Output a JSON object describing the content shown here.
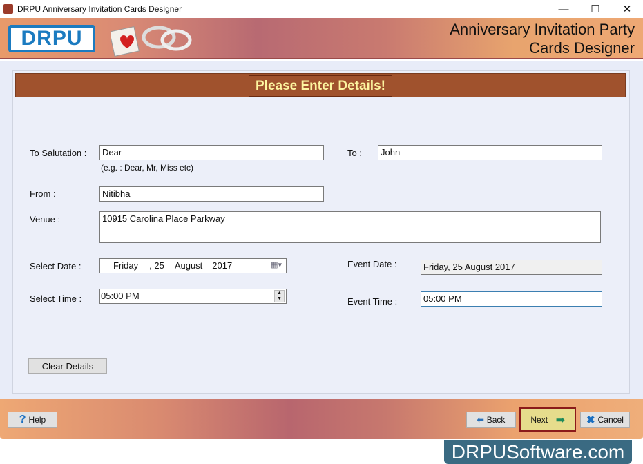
{
  "window": {
    "title": "DRPU Anniversary Invitation Cards Designer",
    "minimize": "—",
    "maximize": "☐",
    "close": "✕"
  },
  "banner": {
    "logo": "DRPU",
    "title_line1": "Anniversary Invitation Party",
    "title_line2": "Cards Designer"
  },
  "header": {
    "label": "Please Enter Details!"
  },
  "form": {
    "salutation_label": "To Salutation :",
    "salutation_value": "Dear",
    "salutation_hint": "(e.g. : Dear, Mr, Miss etc)",
    "to_label": "To :",
    "to_value": "John",
    "from_label": "From :",
    "from_value": "Nitibha",
    "venue_label": "Venue :",
    "venue_value": "10915 Carolina Place Parkway",
    "select_date_label": "Select Date :",
    "date_weekday": "Friday",
    "date_day": ", 25",
    "date_month": "August",
    "date_year": "2017",
    "select_time_label": "Select Time :",
    "time_value": "05:00 PM",
    "event_date_label": "Event Date :",
    "event_date_value": "Friday, 25 August 2017",
    "event_time_label": "Event Time :",
    "event_time_value": "05:00 PM",
    "clear_label": "Clear Details"
  },
  "footer": {
    "help": "Help",
    "back": "Back",
    "next": "Next",
    "cancel": "Cancel"
  },
  "watermark": "DRPUSoftware.com"
}
